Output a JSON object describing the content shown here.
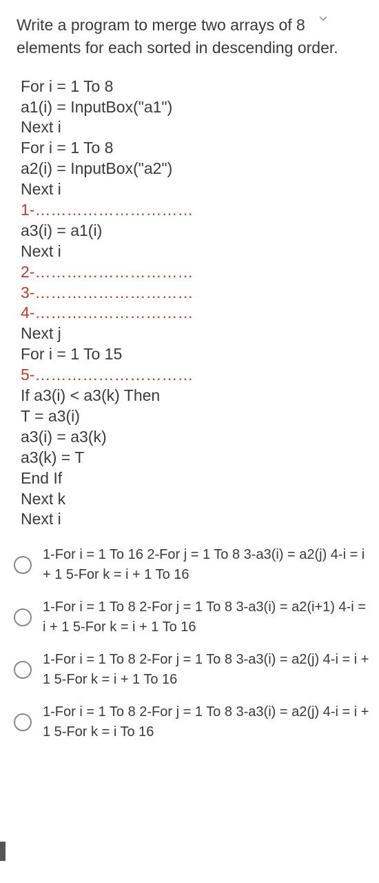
{
  "question": "Write a program to merge two arrays of 8 elements for each sorted in descending order.",
  "code": {
    "l1": "For i = 1 To 8",
    "l2": "a1(i) = InputBox(\"a1\")",
    "l3": "Next i",
    "l4": "For i = 1 To 8",
    "l5": "a2(i) = InputBox(\"a2\")",
    "l6": "Next i",
    "b1": "1-…………………………",
    "l7": "a3(i) = a1(i)",
    "l8": "Next i",
    "b2": "2-…………………………",
    "b3": "3-…………………………",
    "b4": "4-…………………………",
    "l9": "Next j",
    "l10": "For i = 1 To 15",
    "b5": "5-…………………………",
    "l11": "If a3(i) < a3(k) Then",
    "l12": "T = a3(i)",
    "l13": "a3(i) = a3(k)",
    "l14": "a3(k) = T",
    "l15": "End If",
    "l16": "Next k",
    "l17": "Next i"
  },
  "options": [
    "1-For i = 1 To 16 2-For j = 1 To 8 3-a3(i) = a2(j) 4-i = i + 1 5-For k = i + 1 To 16",
    "1-For i = 1 To 8 2-For j = 1 To 8 3-a3(i) = a2(i+1) 4-i = i + 1 5-For k = i + 1 To 16",
    "1-For i = 1 To 8 2-For j = 1 To 8 3-a3(i) = a2(j) 4-i = i + 1 5-For k = i + 1 To 16",
    "1-For i = 1 To 8 2-For j = 1 To 8 3-a3(i) = a2(j) 4-i = i + 1 5-For k = i To 16"
  ]
}
